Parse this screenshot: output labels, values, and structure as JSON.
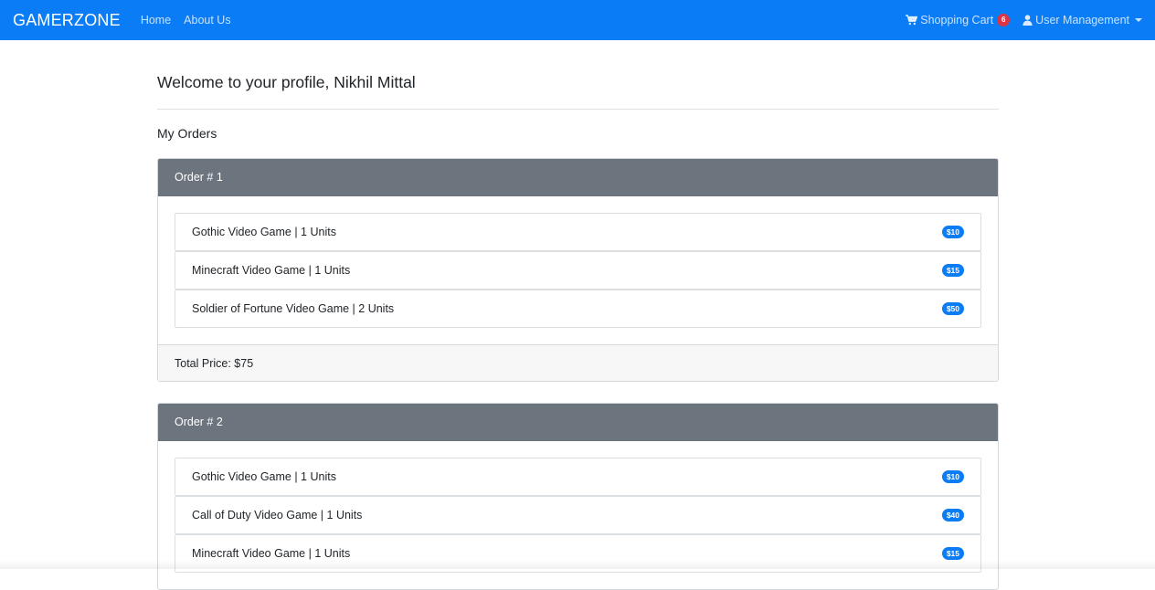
{
  "navbar": {
    "brand": "GAMERZONE",
    "links": [
      "Home",
      "About Us"
    ],
    "cart_label": "Shopping Cart",
    "cart_count": "6",
    "user_menu_label": "User Management",
    "colors": {
      "background": "#0a7cf5",
      "badge": "#dc3545"
    }
  },
  "profile": {
    "title": "Welcome to your profile, Nikhil Mittal",
    "orders_heading": "My Orders"
  },
  "orders": [
    {
      "header": "Order # 1",
      "items": [
        {
          "name": "Gothic Video Game | 1 Units",
          "price": "$10"
        },
        {
          "name": "Minecraft Video Game | 1 Units",
          "price": "$15"
        },
        {
          "name": "Soldier of Fortune Video Game | 2 Units",
          "price": "$50"
        }
      ],
      "total": "Total Price: $75"
    },
    {
      "header": "Order # 2",
      "items": [
        {
          "name": "Gothic Video Game | 1 Units",
          "price": "$10"
        },
        {
          "name": "Call of Duty Video Game | 1 Units",
          "price": "$40"
        },
        {
          "name": "Minecraft Video Game | 1 Units",
          "price": "$15"
        }
      ]
    }
  ]
}
